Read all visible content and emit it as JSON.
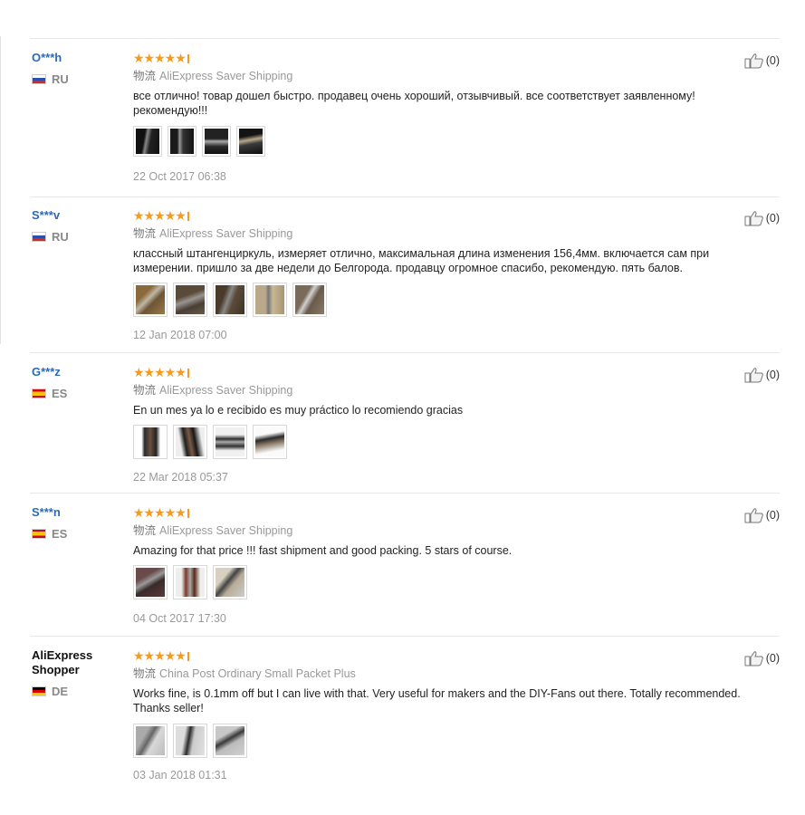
{
  "reviews": [
    {
      "user": "O***h",
      "country": "RU",
      "flag": "ru",
      "rating_stars": "★★★★★",
      "rating": 5,
      "shipping_cn": "物流",
      "shipping": "AliExpress Saver Shipping",
      "text": "все отлично! товар дошел быстро. продавец очень хороший, отзывчивый. все соответствует заявленному! рекомендую!!!",
      "images": 4,
      "date": "22 Oct 2017 06:38",
      "likes": "(0)"
    },
    {
      "user": "S***v",
      "country": "RU",
      "flag": "ru",
      "rating_stars": "★★★★★",
      "rating": 5,
      "shipping_cn": "物流",
      "shipping": "AliExpress Saver Shipping",
      "text": "классный штангенциркуль, измеряет отлично, максимальная длина изменения 156,4мм. включается сам при измерении. пришло за две недели до Белгорода. продавцу огромное спасибо, рекомендую. пять балов.",
      "images": 5,
      "date": "12 Jan 2018 07:00",
      "likes": "(0)"
    },
    {
      "user": "G***z",
      "country": "ES",
      "flag": "es",
      "rating_stars": "★★★★★",
      "rating": 5,
      "shipping_cn": "物流",
      "shipping": "AliExpress Saver Shipping",
      "text": "En un mes ya lo e recibido es muy práctico lo recomiendo gracias",
      "images": 4,
      "date": "22 Mar 2018 05:37",
      "likes": "(0)"
    },
    {
      "user": "S***n",
      "country": "ES",
      "flag": "es",
      "rating_stars": "★★★★★",
      "rating": 5,
      "shipping_cn": "物流",
      "shipping": "AliExpress Saver Shipping",
      "text": "Amazing for that price !!! fast shipment and good packing. 5 stars of course.",
      "images": 3,
      "date": "04 Oct 2017 17:30",
      "likes": "(0)"
    },
    {
      "user": "AliExpress Shopper",
      "country": "DE",
      "flag": "de",
      "rating_stars": "★★★★★",
      "rating": 5,
      "shipping_cn": "物流",
      "shipping": "China Post Ordinary Small Packet Plus",
      "text": "Works fine, is 0.1mm off but I can live with that. Very useful for makers and the DIY-Fans out there. Totally recommended. Thanks seller!",
      "images": 3,
      "date": "03 Jan 2018 01:31",
      "likes": "(0)"
    }
  ]
}
